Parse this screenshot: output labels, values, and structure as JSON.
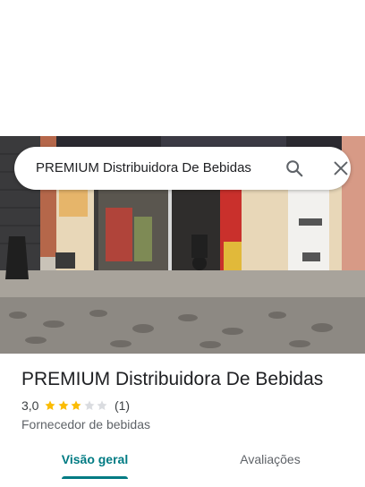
{
  "search": {
    "query": "PREMIUM Distribuidora De Bebidas"
  },
  "place": {
    "name": "PREMIUM Distribuidora De Bebidas",
    "rating": "3,0",
    "rating_stars": 3,
    "max_stars": 5,
    "review_count": "(1)",
    "category": "Fornecedor de bebidas"
  },
  "tabs": [
    {
      "label": "Visão geral",
      "active": true
    },
    {
      "label": "Avaliações",
      "active": false
    }
  ],
  "colors": {
    "accent": "#007b83",
    "star": "#fbbc04",
    "star_empty": "#dadce0"
  }
}
